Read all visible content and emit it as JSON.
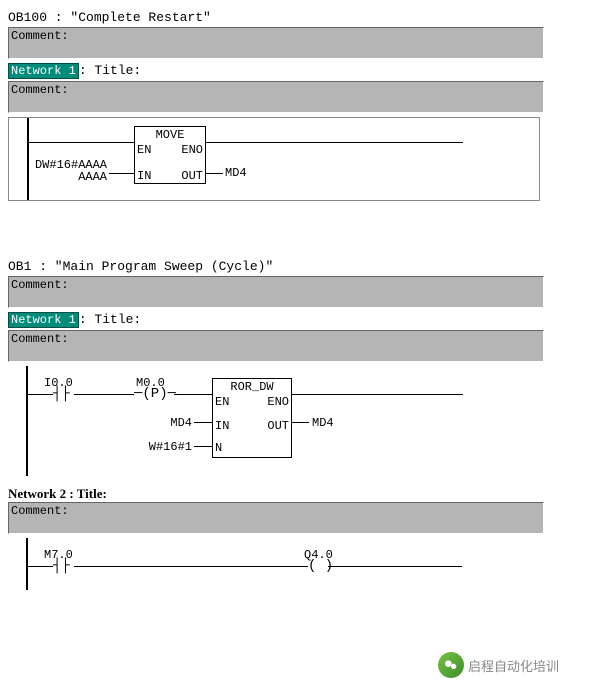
{
  "ob100": {
    "header": "OB100 :  \"Complete Restart\"",
    "comment_label": "Comment:",
    "network1": {
      "label": "Network 1",
      "title_suffix": ": Title:",
      "comment_label": "Comment:",
      "block": {
        "name": "MOVE",
        "en": "EN",
        "eno": "ENO",
        "in": "IN",
        "out": "OUT",
        "input_label_top": "DW#16#AAAA",
        "input_label_bottom": "AAAA",
        "output_label": "MD4"
      }
    }
  },
  "ob1": {
    "header": "OB1 :  \"Main Program Sweep (Cycle)\"",
    "comment_label": "Comment:",
    "network1": {
      "label": "Network 1",
      "title_suffix": ": Title:",
      "comment_label": "Comment:",
      "contact1": "I0.0",
      "contact2": "M0.0",
      "contact2_type": "(P)",
      "block": {
        "name": "ROR_DW",
        "en": "EN",
        "eno": "ENO",
        "in": "IN",
        "out": "OUT",
        "n": "N",
        "in_val": "MD4",
        "n_val": "W#16#1",
        "out_val": "MD4"
      }
    },
    "network2": {
      "title_line": "Network 2 : Title:",
      "comment_label": "Comment:",
      "contact": "M7.0",
      "coil": "Q4.0"
    }
  },
  "watermark": "启程自动化培训"
}
